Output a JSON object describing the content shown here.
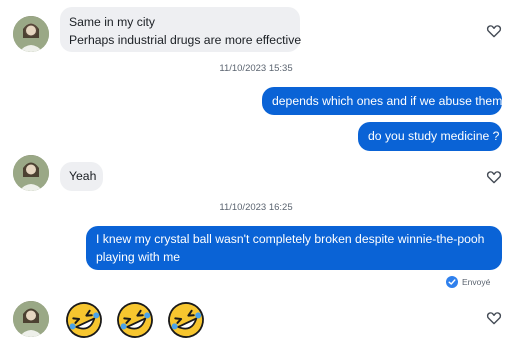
{
  "messages": {
    "m1_line1": "Same in my city",
    "m1_line2": "Perhaps industrial drugs are more effective",
    "ts1": "11/10/2023 15:35",
    "m2": "depends which ones and if we abuse them",
    "m3": "do you study medicine ?",
    "m4": "Yeah",
    "ts2": "11/10/2023 16:25",
    "m5_line1": "I knew my crystal ball wasn't completely broken despite winnie-the-pooh",
    "m5_line2": "playing with me",
    "status": "Envoyé",
    "emojis": [
      "rolling-on-floor-laughing",
      "rolling-on-floor-laughing",
      "rolling-on-floor-laughing"
    ]
  },
  "colors": {
    "outgoing_bubble": "#0a63d6",
    "incoming_bubble": "#eeeff2",
    "status_check": "#2f80ed"
  },
  "icons": [
    "heart-icon",
    "check-icon"
  ]
}
